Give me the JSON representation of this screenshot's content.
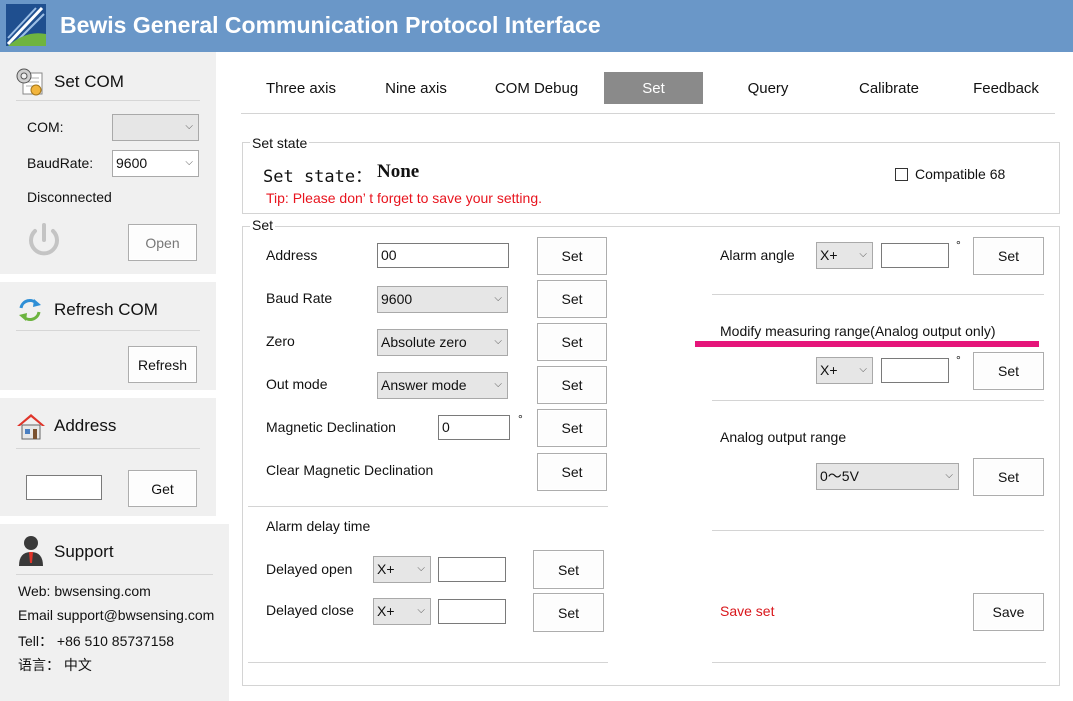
{
  "app": {
    "title": "Bewis General Communication Protocol Interface",
    "logo_icon": "bewis-logo-icon",
    "logo_text": "Bewis"
  },
  "sidebar": {
    "set_com": {
      "title": "Set COM",
      "icon": "settings-window-icon",
      "com_label": "COM:",
      "com_value": "",
      "baud_label": "BaudRate:",
      "baud_value": "9600",
      "status": "Disconnected",
      "power_icon": "power-icon",
      "open_label": "Open"
    },
    "refresh_com": {
      "title": "Refresh COM",
      "icon": "refresh-arrows-icon",
      "refresh_label": "Refresh"
    },
    "address": {
      "title": "Address",
      "icon": "house-icon",
      "value": "",
      "get_label": "Get"
    },
    "support": {
      "title": "Support",
      "icon": "support-person-icon",
      "web": "Web: bwsensing.com",
      "email": "Email support@bwsensing.com",
      "tel": "Tell： +86 510 85737158",
      "language": "语言： 中文"
    }
  },
  "tabs": [
    {
      "label": "Three axis",
      "active": false
    },
    {
      "label": "Nine axis",
      "active": false
    },
    {
      "label": "COM Debug",
      "active": false
    },
    {
      "label": "Set",
      "active": true
    },
    {
      "label": "Query",
      "active": false
    },
    {
      "label": "Calibrate",
      "active": false
    },
    {
      "label": "Feedback",
      "active": false
    }
  ],
  "set_state_group": {
    "title": "Set state",
    "state_label": "Set state：",
    "state_value": "None",
    "tip": "Tip: Please don’ t forget to save your setting.",
    "compatible_label": "Compatible 68",
    "compatible_checked": false
  },
  "set_group": {
    "title": "Set",
    "button_label": "Set",
    "rows": {
      "address": {
        "label": "Address",
        "value": "00"
      },
      "baud_rate": {
        "label": "Baud Rate",
        "value": "9600"
      },
      "zero": {
        "label": "Zero",
        "value": "Absolute zero"
      },
      "out_mode": {
        "label": "Out mode",
        "value": "Answer mode"
      },
      "magnetic_declination": {
        "label": "Magnetic Declination",
        "value": "0",
        "unit": "°"
      },
      "clear_magnetic_declination": {
        "label": "Clear Magnetic Declination"
      }
    },
    "alarm_delay": {
      "title": "Alarm delay time",
      "delayed_open": {
        "label": "Delayed open",
        "axis": "X+",
        "value": ""
      },
      "delayed_close": {
        "label": "Delayed close",
        "axis": "X+",
        "value": ""
      }
    },
    "alarm_angle": {
      "label": "Alarm angle",
      "axis": "X+",
      "value": "",
      "unit": "°"
    },
    "measuring_range": {
      "title": "Modify measuring range(Analog output only)",
      "axis": "X+",
      "value": "",
      "unit": "°",
      "underline_color": "#e5157a"
    },
    "analog_output": {
      "title": "Analog output range",
      "value": "0～5V"
    },
    "save": {
      "label": "Save set",
      "button_label": "Save"
    }
  },
  "colors": {
    "titlebar": "#6a97c8",
    "active_tab": "#8a8a8a",
    "sidebar_bg": "#f0f0f0",
    "tip_red": "#e8141e",
    "highlight_pink": "#e5157a"
  }
}
